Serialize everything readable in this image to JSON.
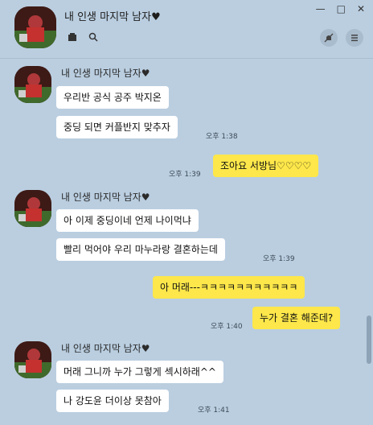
{
  "header": {
    "title": "내 인생 마지막 남자♥",
    "controls": {
      "minimize": "—",
      "maximize": "□",
      "close": "✕"
    }
  },
  "messages": [
    {
      "sender": "내 인생 마지막 남자♥",
      "bubbles": [
        "우리반 공식 공주 박지온",
        "중딩 되면 커플반지 맞추자"
      ],
      "time": "오후 1:38"
    },
    {
      "mine": true,
      "bubbles": [
        "조아요 서방님♡♡♡♡"
      ],
      "time": "오후 1:39"
    },
    {
      "sender": "내 인생 마지막 남자♥",
      "bubbles": [
        "아 이제 중딩이네 언제 나이먹냐",
        "빨리 먹어야 우리 마누라랑 결혼하는데"
      ],
      "time": "오후 1:39"
    },
    {
      "mine": true,
      "bubbles": [
        "아 머래---ㅋㅋㅋㅋㅋㅋㅋㅋㅋㅋㅋ",
        "누가 결혼 해준데?"
      ],
      "time": "오후 1:40"
    },
    {
      "sender": "내 인생 마지막 남자♥",
      "bubbles": [
        "머래 그니까 누가 그렇게 섹시하래^^",
        "나 강도윤 더이상 못참아"
      ],
      "time": "오후 1:41"
    }
  ],
  "colors": {
    "background": "#bacee0",
    "my_bubble": "#fde74a",
    "their_bubble": "#ffffff"
  }
}
